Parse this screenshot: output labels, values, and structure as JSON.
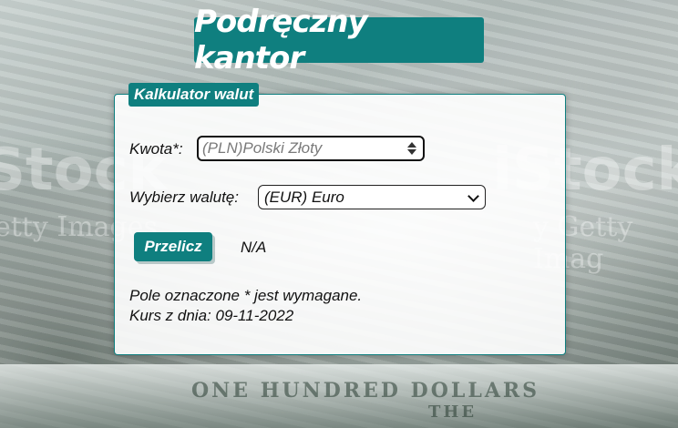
{
  "header": {
    "title": "Podręczny kantor"
  },
  "calculator": {
    "legend": "Kalkulator walut",
    "amount": {
      "label": "Kwota*:",
      "placeholder": "(PLN)Polski Złoty",
      "value": ""
    },
    "currency": {
      "label": "Wybierz walutę:",
      "selected": "(EUR) Euro"
    },
    "convert_label": "Przelicz",
    "result": "N/A",
    "required_note": "Pole oznaczone * jest wymagane.",
    "rate_date": "Kurs z dnia: 09-11-2022"
  },
  "background": {
    "watermark_left": "iStock",
    "watermark_right": "iStock",
    "watermark_sub_left": "etty Images",
    "watermark_sub_right": "y Getty Imag",
    "bill_text_1": "ONE HUNDRED DOLLARS",
    "bill_text_2": "THE"
  },
  "colors": {
    "accent": "#0f7f7f"
  }
}
